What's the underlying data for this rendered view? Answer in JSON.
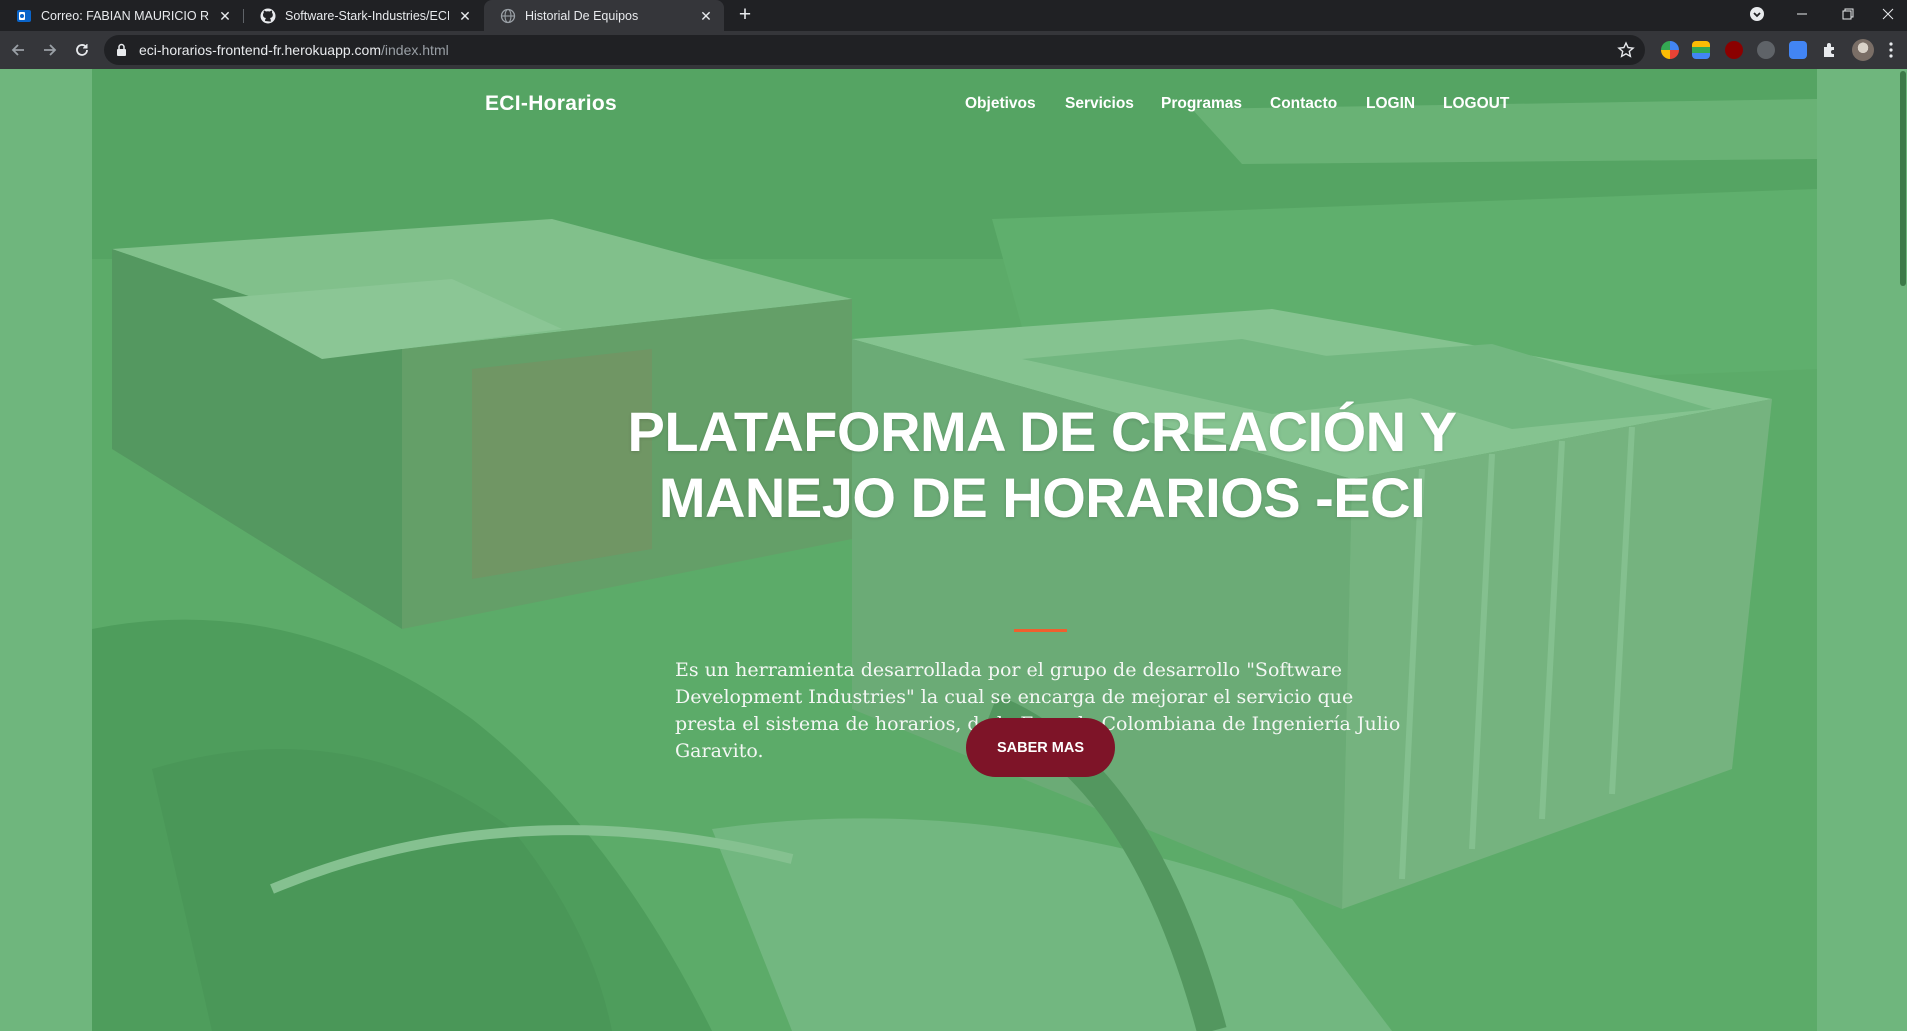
{
  "browser": {
    "tabs": [
      {
        "title": "Correo: FABIAN MAURICIO RAMI",
        "icon": "outlook-icon"
      },
      {
        "title": "Software-Stark-Industries/ECIHO",
        "icon": "github-icon"
      },
      {
        "title": "Historial De Equipos",
        "icon": "globe-icon"
      }
    ],
    "url_host": "eci-horarios-frontend-fr.herokuapp.com",
    "url_path": "/index.html"
  },
  "site": {
    "brand": "ECI-Horarios",
    "nav": [
      "Objetivos",
      "Servicios",
      "Programas",
      "Contacto",
      "LOGIN",
      "LOGOUT"
    ]
  },
  "hero": {
    "headline_line1": "PLATAFORMA DE CREACIÓN Y",
    "headline_line2": "MANEJO DE HORARIOS -ECI",
    "lead": "Es un herramienta desarrollada por el grupo de desarrollo \"Software Development Industries\" la cual se encarga de mejorar el servicio que presta el sistema de horarios, de la Escuela Colombiana de Ingeniería Julio Garavito.",
    "cta_label": "SABER MAS"
  },
  "colors": {
    "overlay_green": "#68ba78",
    "cta_maroon": "#7e1428",
    "divider_orange": "#f05f2e"
  }
}
